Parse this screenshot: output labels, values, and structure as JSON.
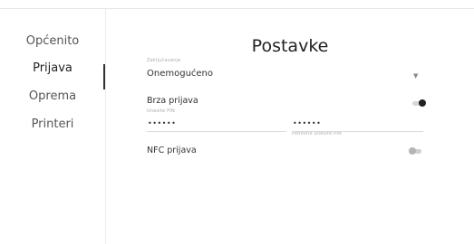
{
  "sidebar": {
    "items": [
      {
        "label": "Općenito"
      },
      {
        "label": "Prijava"
      },
      {
        "label": "Oprema"
      },
      {
        "label": "Printeri"
      }
    ]
  },
  "page": {
    "title": "Postavke"
  },
  "lock_select": {
    "caption": "Zaključavanje",
    "value": "Onemogućeno"
  },
  "quick_login": {
    "label": "Brza prijava",
    "pin_caption": "Unesite PIN",
    "pin_value": "••••••",
    "repeat_pin_caption": "Ponovno unesite PIN",
    "repeat_pin_value": "••••••",
    "enabled": true
  },
  "nfc_login": {
    "label": "NFC prijava",
    "enabled": false
  },
  "colors": {
    "accent": "#222222",
    "toggle_off": "#b5b5b5"
  }
}
